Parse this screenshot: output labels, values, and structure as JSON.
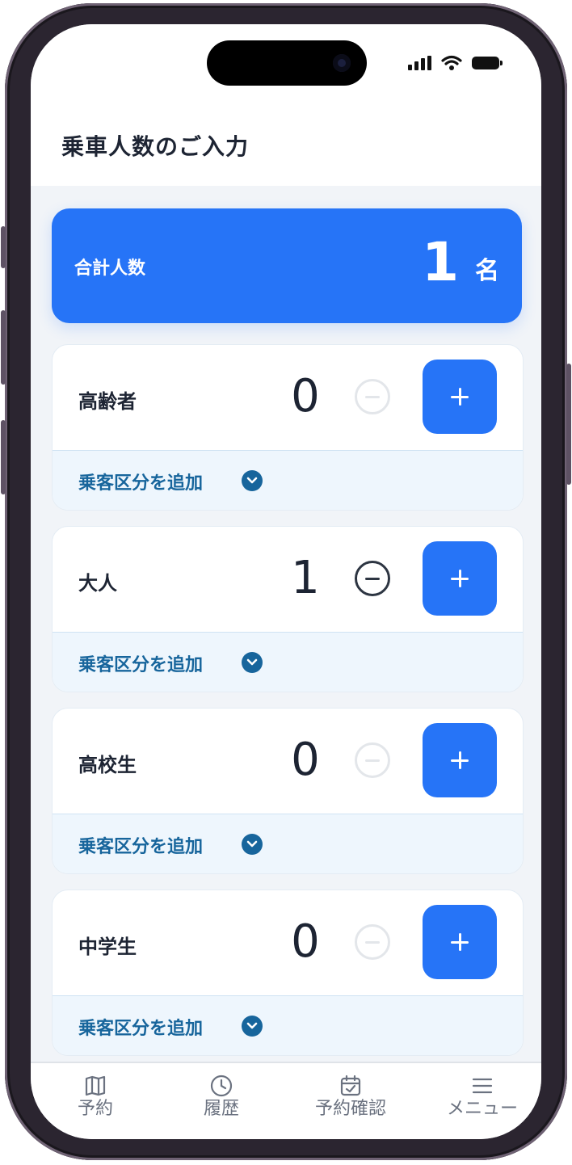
{
  "status_bar": {
    "icons": [
      "signal-icon",
      "wifi-icon",
      "battery-icon"
    ]
  },
  "header": {
    "title": "乗車人数のご入力"
  },
  "total": {
    "label": "合計人数",
    "value": "1",
    "unit": "名"
  },
  "categories": [
    {
      "name": "高齢者",
      "count": "0",
      "minus_enabled": false,
      "add_label": "乗客区分を追加"
    },
    {
      "name": "大人",
      "count": "1",
      "minus_enabled": true,
      "add_label": "乗客区分を追加"
    },
    {
      "name": "高校生",
      "count": "0",
      "minus_enabled": false,
      "add_label": "乗客区分を追加"
    },
    {
      "name": "中学生",
      "count": "0",
      "minus_enabled": false,
      "add_label": "乗客区分を追加"
    }
  ],
  "nav": [
    {
      "label": "予約",
      "icon": "map-icon"
    },
    {
      "label": "履歴",
      "icon": "clock-icon"
    },
    {
      "label": "予約確認",
      "icon": "calendar-check-icon"
    },
    {
      "label": "メニュー",
      "icon": "menu-icon"
    }
  ],
  "colors": {
    "accent": "#2674f7",
    "add_text": "#17659c",
    "add_bg": "#eef6fd"
  }
}
